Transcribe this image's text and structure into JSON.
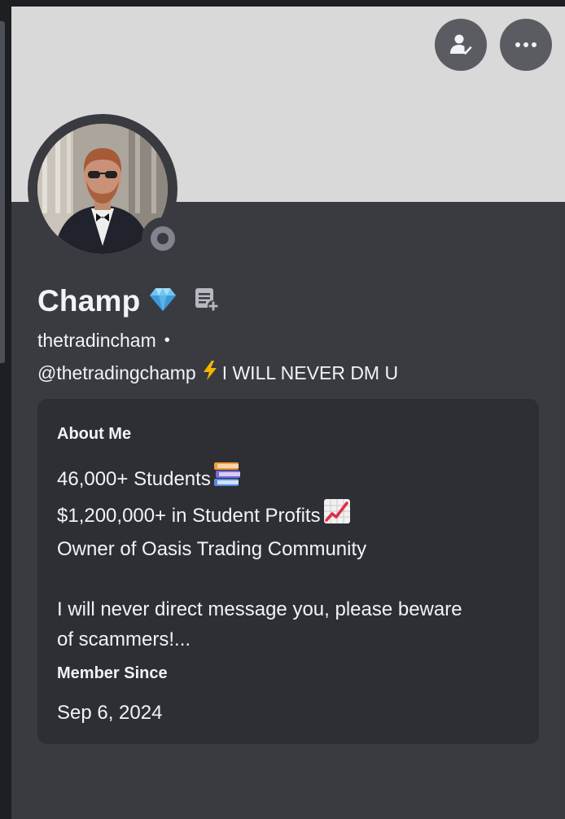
{
  "profile": {
    "display_name": "Champ",
    "username": "thetradincham",
    "separator": "•",
    "pronouns_prefix": "@thetradingchamp",
    "pronouns_suffix": "I WILL NEVER DM U",
    "status": "offline"
  },
  "actions": {
    "friend_icon": "add-friend-icon",
    "more_icon": "more-options-icon"
  },
  "about": {
    "title": "About Me",
    "lines": [
      "46,000+ Students",
      "$1,200,000+ in Student Profits",
      "Owner of Oasis Trading Community",
      "I will never direct message you, please beware",
      "of scammers!..."
    ]
  },
  "member_since": {
    "title": "Member Since",
    "date": "Sep 6, 2024"
  },
  "colors": {
    "banner": "#d9d9d9",
    "panel": "#3a3b41",
    "card": "#2e2f34",
    "text": "#f2f3f5",
    "status_offline": "#80848e"
  }
}
